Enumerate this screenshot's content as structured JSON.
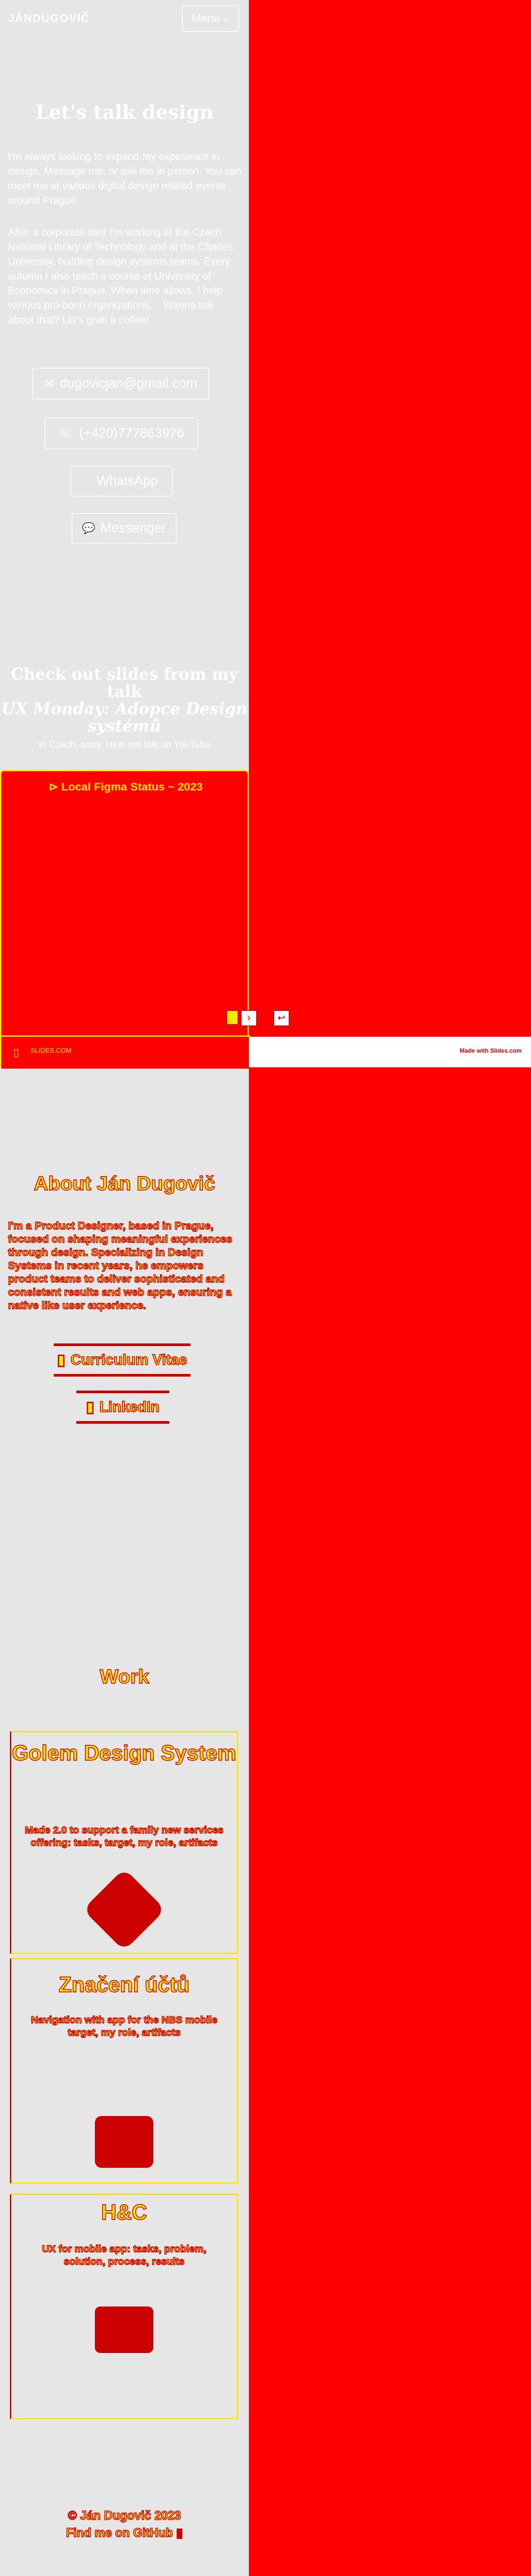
{
  "header": {
    "logo": "JÁNDUGOVIČ",
    "menu_label": "Menu",
    "menu_icon": "chevron-down-icon"
  },
  "contact": {
    "title": "Let's talk design",
    "intro": "I'm always looking to expand my experience in design. Message me, or ask me in person. You can meet me at various digital design related events around Prague.",
    "about": "After a corporate stint I'm working at the Czech National Library of Technology and at the Charles University, building design systems teams. Every autumn I also teach a course at University of Economics in Prague. When time allows, I help various pro-bono organizations.    Wanna talk about that? Let's grab a coffee!",
    "email": "dugovicjan@gmail.com",
    "phone": "(+420)777863976",
    "whatsapp": "WhatsApp",
    "messenger": "Messenger"
  },
  "slides": {
    "title_line1": "Check out slides from my talk",
    "title_line2": "UX Monday: Adopce Design systémů",
    "note": "In Czech, sorry. Hear me talk on YouTube",
    "embed_title": "⊳ Local Figma Status ~ 2023",
    "nav_next": "›",
    "nav_back": "↩",
    "footer_left": "SLIDES.COM",
    "footer_right": "Made with Slides.com"
  },
  "bio": {
    "title": "About Ján Dugovič",
    "text": "I'm a Product Designer, based in Prague, focused on shaping meaningful experiences through design. Specializing in Design Systems in recent years, he empowers product teams to deliver sophisticated and consistent results and web apps, ensuring a native like user experience.",
    "cv_button": "Curriculum Vitae",
    "linkedin_button": "LinkedIn"
  },
  "work": {
    "title": "Work",
    "items": [
      {
        "title": "Golem Design System",
        "subtitle": "Made 2.0 to support a family new services offering: tasks, target, my role, artifacts"
      },
      {
        "title": "Značení účtů",
        "subtitle": "Navigation with app for the NBS mobile target, my role, artifacts"
      },
      {
        "title": "H&C",
        "subtitle": "UX for mobile app: tasks, problem, solution, process, results"
      }
    ]
  },
  "footer": {
    "copyright": "© Ján Dugovič 2023",
    "tagline": "Find me on GitHub"
  },
  "colors": {
    "page_bg": "#ff0000",
    "column_bg": "#e6e6e6",
    "accent_yellow": "#ffe800",
    "accent_red": "#cc0000"
  }
}
